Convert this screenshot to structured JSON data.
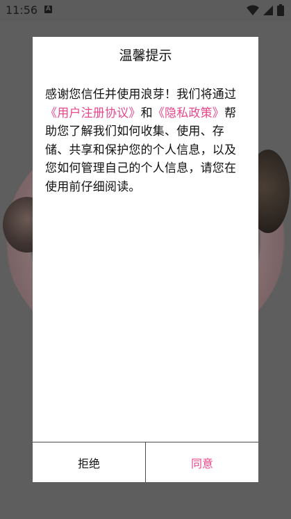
{
  "status_bar": {
    "time": "11:56",
    "notification_icon": "a-icon",
    "icons": [
      "wifi-icon",
      "signal-icon",
      "battery-icon"
    ]
  },
  "dialog": {
    "title": "温馨提示",
    "body": {
      "text_before": "感谢您信任并使用浪芽！我们将通过",
      "link_user_agreement": "《用户注册协议》",
      "text_and": "和",
      "link_privacy_policy": "《隐私政策》",
      "text_after": "帮助您了解我们如何收集、使用、存储、共享和保护您的个人信息，以及您如何管理自己的个人信息，请您在使用前仔细阅读。"
    },
    "buttons": {
      "reject_label": "拒绝",
      "agree_label": "同意"
    }
  },
  "colors": {
    "accent": "#e8478b",
    "overlay": "#5e5e5e"
  }
}
